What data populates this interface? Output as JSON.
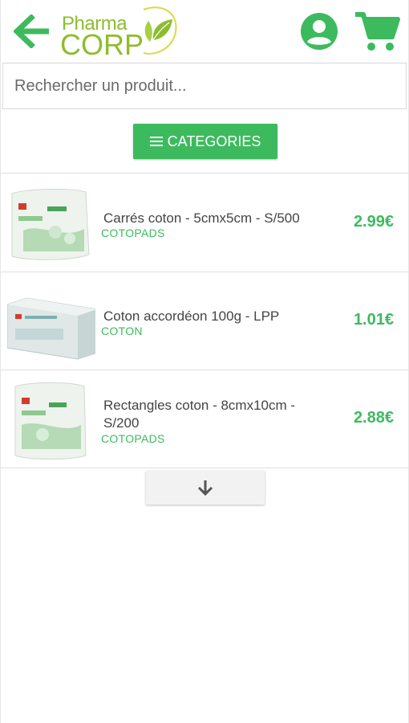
{
  "header": {
    "logo_top": "Pharma",
    "logo_bottom": "CORP"
  },
  "search": {
    "placeholder": "Rechercher un produit..."
  },
  "categories_button": {
    "label": "CATEGORIES"
  },
  "products": [
    {
      "name": "Carrés coton - 5cmx5cm - S/500",
      "category": "COTOPADS",
      "price": "2.99€"
    },
    {
      "name": "Coton accordéon 100g - LPP",
      "category": "COTON",
      "price": "1.01€"
    },
    {
      "name": "Rectangles coton - 8cmx10cm - S/200",
      "category": "COTOPADS",
      "price": "2.88€"
    }
  ],
  "colors": {
    "accent": "#3dba5e",
    "logo": "#8dbd2e"
  },
  "icons": {
    "back": "arrow-left-icon",
    "account": "user-circle-icon",
    "cart": "shopping-cart-icon",
    "menu": "hamburger-icon",
    "load_more": "arrow-down-icon"
  }
}
